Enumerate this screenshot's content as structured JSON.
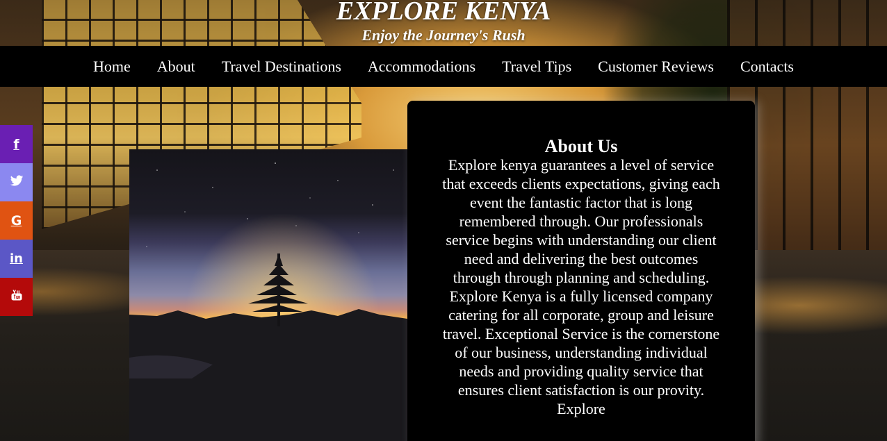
{
  "header": {
    "title": "EXPLORE KENYA",
    "tagline": "Enjoy the Journey's Rush"
  },
  "nav": {
    "items": [
      {
        "label": "Home"
      },
      {
        "label": "About"
      },
      {
        "label": "Travel Destinations"
      },
      {
        "label": "Accommodations"
      },
      {
        "label": "Travel Tips"
      },
      {
        "label": "Customer Reviews"
      },
      {
        "label": "Contacts"
      }
    ]
  },
  "social": {
    "items": [
      {
        "icon": "facebook-icon",
        "glyph": "f",
        "color": "#6a1fb3"
      },
      {
        "icon": "twitter-icon",
        "glyph": "",
        "color": "#8b88f0"
      },
      {
        "icon": "google-icon",
        "glyph": "G",
        "color": "#e05312"
      },
      {
        "icon": "linkedin-icon",
        "glyph": "in",
        "color": "#5b57c6"
      },
      {
        "icon": "youtube-icon",
        "glyph": "",
        "color": "#b40a0a"
      }
    ]
  },
  "about": {
    "title": "About Us",
    "body": "Explore kenya guarantees a level of service that exceeds clients expectations, giving each event the fantastic factor that is long remembered through. Our professionals service begins with understanding our client need and delivering the best outcomes through through planning and scheduling. Explore Kenya is a fully licensed company catering for all corporate, group and leisure travel. Exceptional Service is the cornerstone of our business, understanding individual needs and providing quality service that ensures client satisfaction is our provity. Explore"
  },
  "colors": {
    "navbar": "#000000",
    "card": "#000000",
    "text": "#ffffff"
  }
}
